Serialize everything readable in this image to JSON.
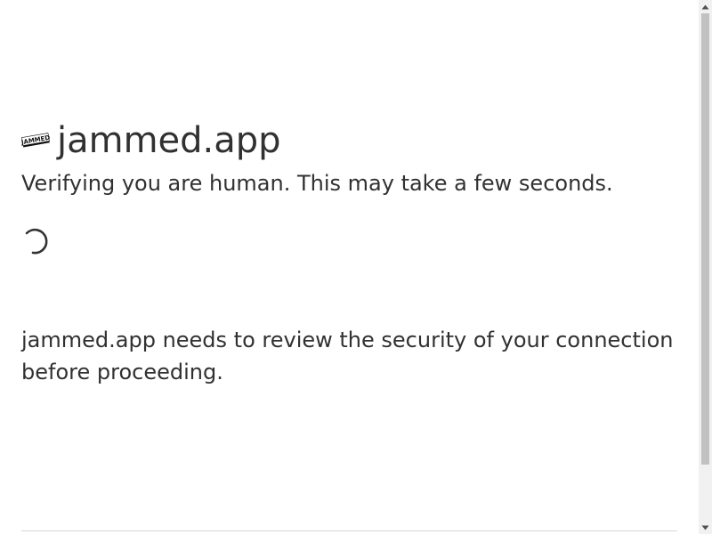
{
  "page": {
    "site_name": "jammed.app",
    "favicon": {
      "icon": "site-logo-icon",
      "text": "JAMMED"
    },
    "subtitle": "Verifying you are human. This may take a few seconds.",
    "spinner_icon": "loading-spinner-icon",
    "message": "jammed.app needs to review the security of your connection before proceeding."
  },
  "scrollbar": {
    "up_icon": "scroll-up-arrow-icon",
    "down_icon": "scroll-down-arrow-icon"
  },
  "colors": {
    "text": "#313131",
    "background": "#ffffff",
    "divider": "#d9d9d9",
    "scroll_track": "#f1f1f1",
    "scroll_thumb": "#c1c1c1"
  }
}
